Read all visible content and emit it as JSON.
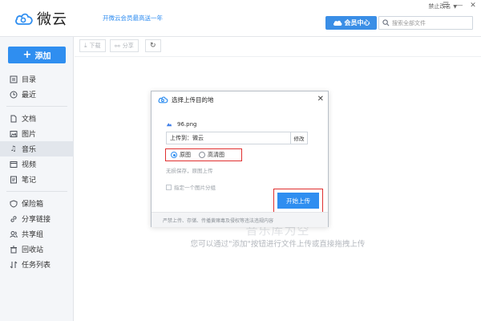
{
  "header": {
    "app_name": "微云",
    "promo_text": "开微云会员最高送一年",
    "user_name": "禁止改名",
    "window_controls": [
      "☰",
      "—",
      "✕"
    ],
    "vip_label": "会员中心",
    "search_placeholder": "搜索全部文件"
  },
  "sidebar": {
    "add_label": "添加",
    "groups": [
      [
        {
          "label": "目录",
          "icon": "directory-icon"
        },
        {
          "label": "最近",
          "icon": "clock-icon"
        }
      ],
      [
        {
          "label": "文档",
          "icon": "document-icon"
        },
        {
          "label": "图片",
          "icon": "image-icon"
        },
        {
          "label": "音乐",
          "icon": "music-icon",
          "active": true
        },
        {
          "label": "视频",
          "icon": "video-icon"
        },
        {
          "label": "笔记",
          "icon": "note-icon"
        }
      ],
      [
        {
          "label": "保险箱",
          "icon": "safe-icon"
        },
        {
          "label": "分享链接",
          "icon": "link-icon"
        },
        {
          "label": "共享组",
          "icon": "group-icon"
        },
        {
          "label": "回收站",
          "icon": "trash-icon"
        },
        {
          "label": "任务列表",
          "icon": "task-list-icon"
        }
      ]
    ]
  },
  "toolbar": {
    "download_label": "下载",
    "share_label": "分享"
  },
  "main": {
    "empty_title": "音乐库为空",
    "empty_hint": "您可以通过\"添加\"按钮进行文件上传或直接拖拽上传"
  },
  "dialog": {
    "title": "选择上传目的地",
    "close": "✕",
    "file_name": "96.png",
    "destination": "上传到：微云",
    "modify_label": "修改",
    "quality_options": [
      {
        "label": "原图",
        "selected": true
      },
      {
        "label": "高清图",
        "selected": false
      }
    ],
    "quality_note": "无损保存，原图上传",
    "checkbox_label": "指定一个图片分组",
    "start_label": "开始上传",
    "footer_note": "严禁上传、存储、传播黄赌毒及侵权等违法违规内容"
  },
  "colors": {
    "accent": "#2f8ef0",
    "highlight_border": "#e03030",
    "sidebar_bg": "#f4f6f9"
  }
}
